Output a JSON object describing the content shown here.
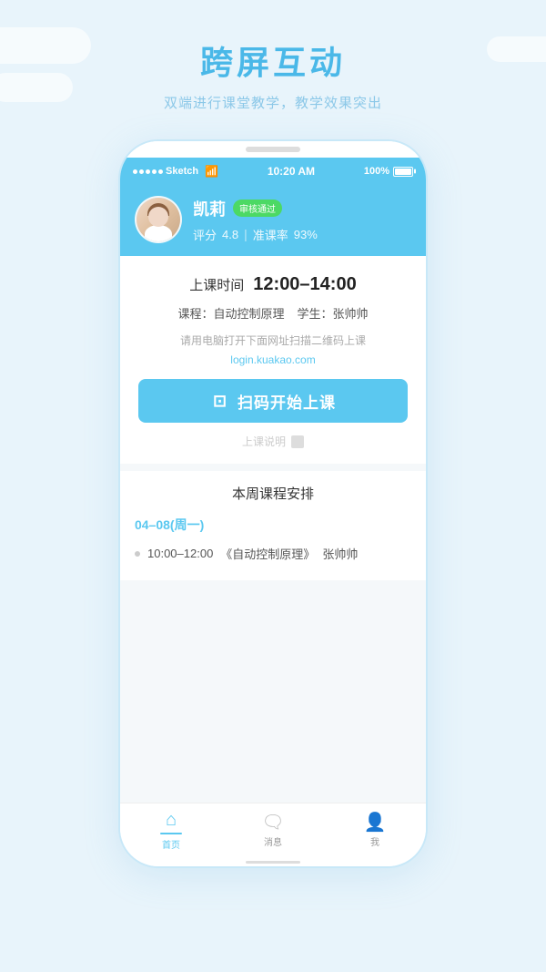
{
  "page": {
    "background_color": "#e8f4fb"
  },
  "header": {
    "title": "跨屏互动",
    "subtitle": "双端进行课堂教学，教学效果突出"
  },
  "status_bar": {
    "carrier": "Sketch",
    "wifi": "📶",
    "time": "10:20 AM",
    "battery": "100%"
  },
  "profile": {
    "name": "凯莉",
    "verified_label": "审核通过",
    "rating_label": "评分",
    "rating_value": "4.8",
    "attendance_label": "准课率",
    "attendance_value": "93%"
  },
  "class_card": {
    "time_label": "上课时间",
    "time_value": "12:00–14:00",
    "course_label": "课程：",
    "course_name": "自动控制原理",
    "student_label": "学生：",
    "student_name": "张帅帅",
    "notice": "请用电脑打开下面网址扫描二维码上课",
    "link": "login.kuakao.com",
    "scan_button_icon": "已",
    "scan_button_label": "扫码开始上课",
    "note_label": "上课说明"
  },
  "schedule": {
    "title": "本周课程安排",
    "date": "04–08(周一)",
    "items": [
      {
        "time": "10:00–12:00",
        "course": "《自动控制原理》",
        "student": "张帅帅"
      }
    ]
  },
  "bottom_nav": {
    "items": [
      {
        "icon": "🏠",
        "label": "首页",
        "active": true
      },
      {
        "icon": "💬",
        "label": "消息",
        "active": false
      },
      {
        "icon": "👤",
        "label": "我",
        "active": false
      }
    ]
  }
}
